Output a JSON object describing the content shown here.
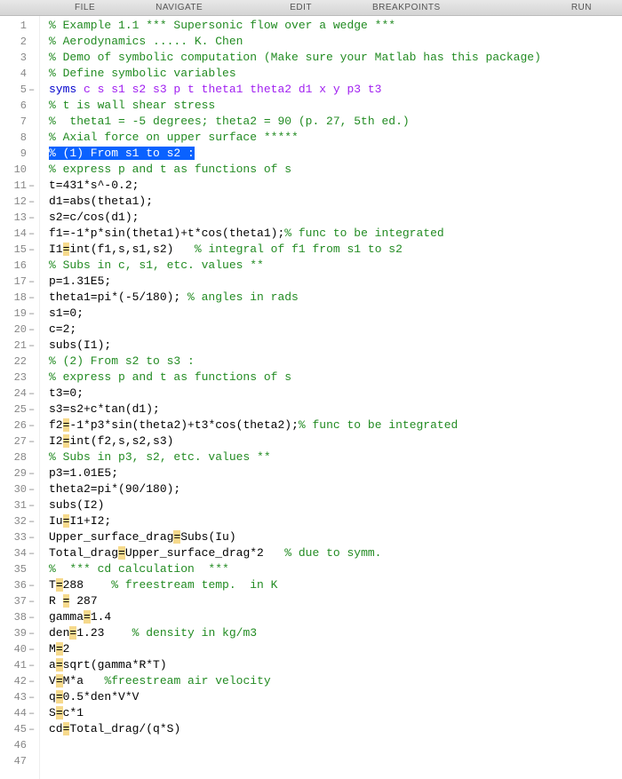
{
  "toolbar": {
    "file": "FILE",
    "navigate": "NAVIGATE",
    "edit": "EDIT",
    "breakpoints": "BREAKPOINTS",
    "run": "RUN"
  },
  "toolbar_offsets": {
    "file": 80,
    "navigate": 190,
    "edit": 345,
    "breakpoints": 450,
    "run": 620
  },
  "selected_line": 9,
  "lines": [
    {
      "n": 1,
      "dash": false,
      "tokens": [
        [
          "c-comment",
          "% Example 1.1 *** Supersonic flow over a wedge ***"
        ]
      ]
    },
    {
      "n": 2,
      "dash": false,
      "tokens": [
        [
          "c-comment",
          "% Aerodynamics ..... K. Chen"
        ]
      ]
    },
    {
      "n": 3,
      "dash": false,
      "tokens": [
        [
          "c-comment",
          "% Demo of symbolic computation (Make sure your Matlab has this package)"
        ]
      ]
    },
    {
      "n": 4,
      "dash": false,
      "tokens": [
        [
          "c-comment",
          "% Define symbolic variables"
        ]
      ]
    },
    {
      "n": 5,
      "dash": true,
      "tokens": [
        [
          "c-keyword",
          "syms "
        ],
        [
          "c-string",
          "c s s1 s2 s3 p t theta1 theta2 d1 x y p3 t3"
        ]
      ]
    },
    {
      "n": 6,
      "dash": false,
      "tokens": [
        [
          "c-comment",
          "% t is wall shear stress"
        ]
      ]
    },
    {
      "n": 7,
      "dash": false,
      "tokens": [
        [
          "c-comment",
          "%  theta1 = -5 degrees; theta2 = 90 (p. 27, 5th ed.)"
        ]
      ]
    },
    {
      "n": 8,
      "dash": false,
      "tokens": [
        [
          "c-comment",
          "% Axial force on upper surface *****"
        ]
      ]
    },
    {
      "n": 9,
      "dash": false,
      "tokens": [
        [
          "c-comment sel",
          "% (1) From s1 to s2 :"
        ]
      ]
    },
    {
      "n": 10,
      "dash": false,
      "tokens": [
        [
          "c-comment",
          "% express p and t as functions of s"
        ]
      ]
    },
    {
      "n": 11,
      "dash": true,
      "tokens": [
        [
          "c-text",
          "t=431*s^-0.2;"
        ]
      ]
    },
    {
      "n": 12,
      "dash": true,
      "tokens": [
        [
          "c-text",
          "d1=abs(theta1);"
        ]
      ]
    },
    {
      "n": 13,
      "dash": true,
      "tokens": [
        [
          "c-text",
          "s2=c/cos(d1);"
        ]
      ]
    },
    {
      "n": 14,
      "dash": true,
      "tokens": [
        [
          "c-text",
          "f1=-1*p*sin(theta1)+t*cos(theta1);"
        ],
        [
          "c-comment",
          "% func to be integrated"
        ]
      ]
    },
    {
      "n": 15,
      "dash": true,
      "tokens": [
        [
          "c-text",
          "I1"
        ],
        [
          "c-text warn",
          "="
        ],
        [
          "c-text",
          "int(f1,s,s1,s2)   "
        ],
        [
          "c-comment",
          "% integral of f1 from s1 to s2"
        ]
      ]
    },
    {
      "n": 16,
      "dash": false,
      "tokens": [
        [
          "c-comment",
          "% Subs in c, s1, etc. values **"
        ]
      ]
    },
    {
      "n": 17,
      "dash": true,
      "tokens": [
        [
          "c-text",
          "p=1.31E5;"
        ]
      ]
    },
    {
      "n": 18,
      "dash": true,
      "tokens": [
        [
          "c-text",
          "theta1=pi*(-5/180); "
        ],
        [
          "c-comment",
          "% angles in rads"
        ]
      ]
    },
    {
      "n": 19,
      "dash": true,
      "tokens": [
        [
          "c-text",
          "s1=0;"
        ]
      ]
    },
    {
      "n": 20,
      "dash": true,
      "tokens": [
        [
          "c-text",
          "c=2;"
        ]
      ]
    },
    {
      "n": 21,
      "dash": true,
      "tokens": [
        [
          "c-text",
          "subs(I1);"
        ]
      ]
    },
    {
      "n": 22,
      "dash": false,
      "tokens": [
        [
          "c-comment",
          "% (2) From s2 to s3 :"
        ]
      ]
    },
    {
      "n": 23,
      "dash": false,
      "tokens": [
        [
          "c-comment",
          "% express p and t as functions of s"
        ]
      ]
    },
    {
      "n": 24,
      "dash": true,
      "tokens": [
        [
          "c-text",
          "t3=0;"
        ]
      ]
    },
    {
      "n": 25,
      "dash": true,
      "tokens": [
        [
          "c-text",
          "s3=s2+c*tan(d1);"
        ]
      ]
    },
    {
      "n": 26,
      "dash": true,
      "tokens": [
        [
          "c-text",
          "f2"
        ],
        [
          "c-text warn",
          "="
        ],
        [
          "c-text",
          "-1*p3*sin(theta2)+t3*cos(theta2);"
        ],
        [
          "c-comment",
          "% func to be integrated"
        ]
      ]
    },
    {
      "n": 27,
      "dash": true,
      "tokens": [
        [
          "c-text",
          "I2"
        ],
        [
          "c-text warn",
          "="
        ],
        [
          "c-text",
          "int(f2,s,s2,s3)"
        ]
      ]
    },
    {
      "n": 28,
      "dash": false,
      "tokens": [
        [
          "c-comment",
          "% Subs in p3, s2, etc. values **"
        ]
      ]
    },
    {
      "n": 29,
      "dash": true,
      "tokens": [
        [
          "c-text",
          "p3=1.01E5;"
        ]
      ]
    },
    {
      "n": 30,
      "dash": true,
      "tokens": [
        [
          "c-text",
          "theta2=pi*(90/180);"
        ]
      ]
    },
    {
      "n": 31,
      "dash": true,
      "tokens": [
        [
          "c-text",
          "subs(I2)"
        ]
      ]
    },
    {
      "n": 32,
      "dash": true,
      "tokens": [
        [
          "c-text",
          "Iu"
        ],
        [
          "c-text warn",
          "="
        ],
        [
          "c-text",
          "I1+I2;"
        ]
      ]
    },
    {
      "n": 33,
      "dash": true,
      "tokens": [
        [
          "c-text",
          "Upper_surface_drag"
        ],
        [
          "c-text warn",
          "="
        ],
        [
          "c-text",
          "Subs(Iu)"
        ]
      ]
    },
    {
      "n": 34,
      "dash": true,
      "tokens": [
        [
          "c-text",
          "Total_drag"
        ],
        [
          "c-text warn",
          "="
        ],
        [
          "c-text",
          "Upper_surface_drag*2   "
        ],
        [
          "c-comment",
          "% due to symm."
        ]
      ]
    },
    {
      "n": 35,
      "dash": false,
      "tokens": [
        [
          "c-comment",
          "%  *** cd calculation  ***"
        ]
      ]
    },
    {
      "n": 36,
      "dash": true,
      "tokens": [
        [
          "c-text",
          "T"
        ],
        [
          "c-text warn",
          "="
        ],
        [
          "c-text",
          "288    "
        ],
        [
          "c-comment",
          "% freestream temp.  in K"
        ]
      ]
    },
    {
      "n": 37,
      "dash": true,
      "tokens": [
        [
          "c-text",
          "R "
        ],
        [
          "c-text warn",
          "="
        ],
        [
          "c-text",
          " 287"
        ]
      ]
    },
    {
      "n": 38,
      "dash": true,
      "tokens": [
        [
          "c-text",
          "gamma"
        ],
        [
          "c-text warn",
          "="
        ],
        [
          "c-text",
          "1.4"
        ]
      ]
    },
    {
      "n": 39,
      "dash": true,
      "tokens": [
        [
          "c-text",
          "den"
        ],
        [
          "c-text warn",
          "="
        ],
        [
          "c-text",
          "1.23    "
        ],
        [
          "c-comment",
          "% density in kg/m3"
        ]
      ]
    },
    {
      "n": 40,
      "dash": true,
      "tokens": [
        [
          "c-text",
          "M"
        ],
        [
          "c-text warn",
          "="
        ],
        [
          "c-text",
          "2"
        ]
      ]
    },
    {
      "n": 41,
      "dash": true,
      "tokens": [
        [
          "c-text",
          "a"
        ],
        [
          "c-text warn",
          "="
        ],
        [
          "c-text",
          "sqrt(gamma*R*T)"
        ]
      ]
    },
    {
      "n": 42,
      "dash": true,
      "tokens": [
        [
          "c-text",
          "V"
        ],
        [
          "c-text warn",
          "="
        ],
        [
          "c-text",
          "M*a   "
        ],
        [
          "c-comment",
          "%freestream air velocity"
        ]
      ]
    },
    {
      "n": 43,
      "dash": true,
      "tokens": [
        [
          "c-text",
          "q"
        ],
        [
          "c-text warn",
          "="
        ],
        [
          "c-text",
          "0.5*den*V*V"
        ]
      ]
    },
    {
      "n": 44,
      "dash": true,
      "tokens": [
        [
          "c-text",
          "S"
        ],
        [
          "c-text warn",
          "="
        ],
        [
          "c-text",
          "c*1"
        ]
      ]
    },
    {
      "n": 45,
      "dash": true,
      "tokens": [
        [
          "c-text",
          "cd"
        ],
        [
          "c-text warn",
          "="
        ],
        [
          "c-text",
          "Total_drag/(q*S)"
        ]
      ]
    },
    {
      "n": 46,
      "dash": false,
      "tokens": []
    },
    {
      "n": 47,
      "dash": false,
      "tokens": []
    }
  ]
}
